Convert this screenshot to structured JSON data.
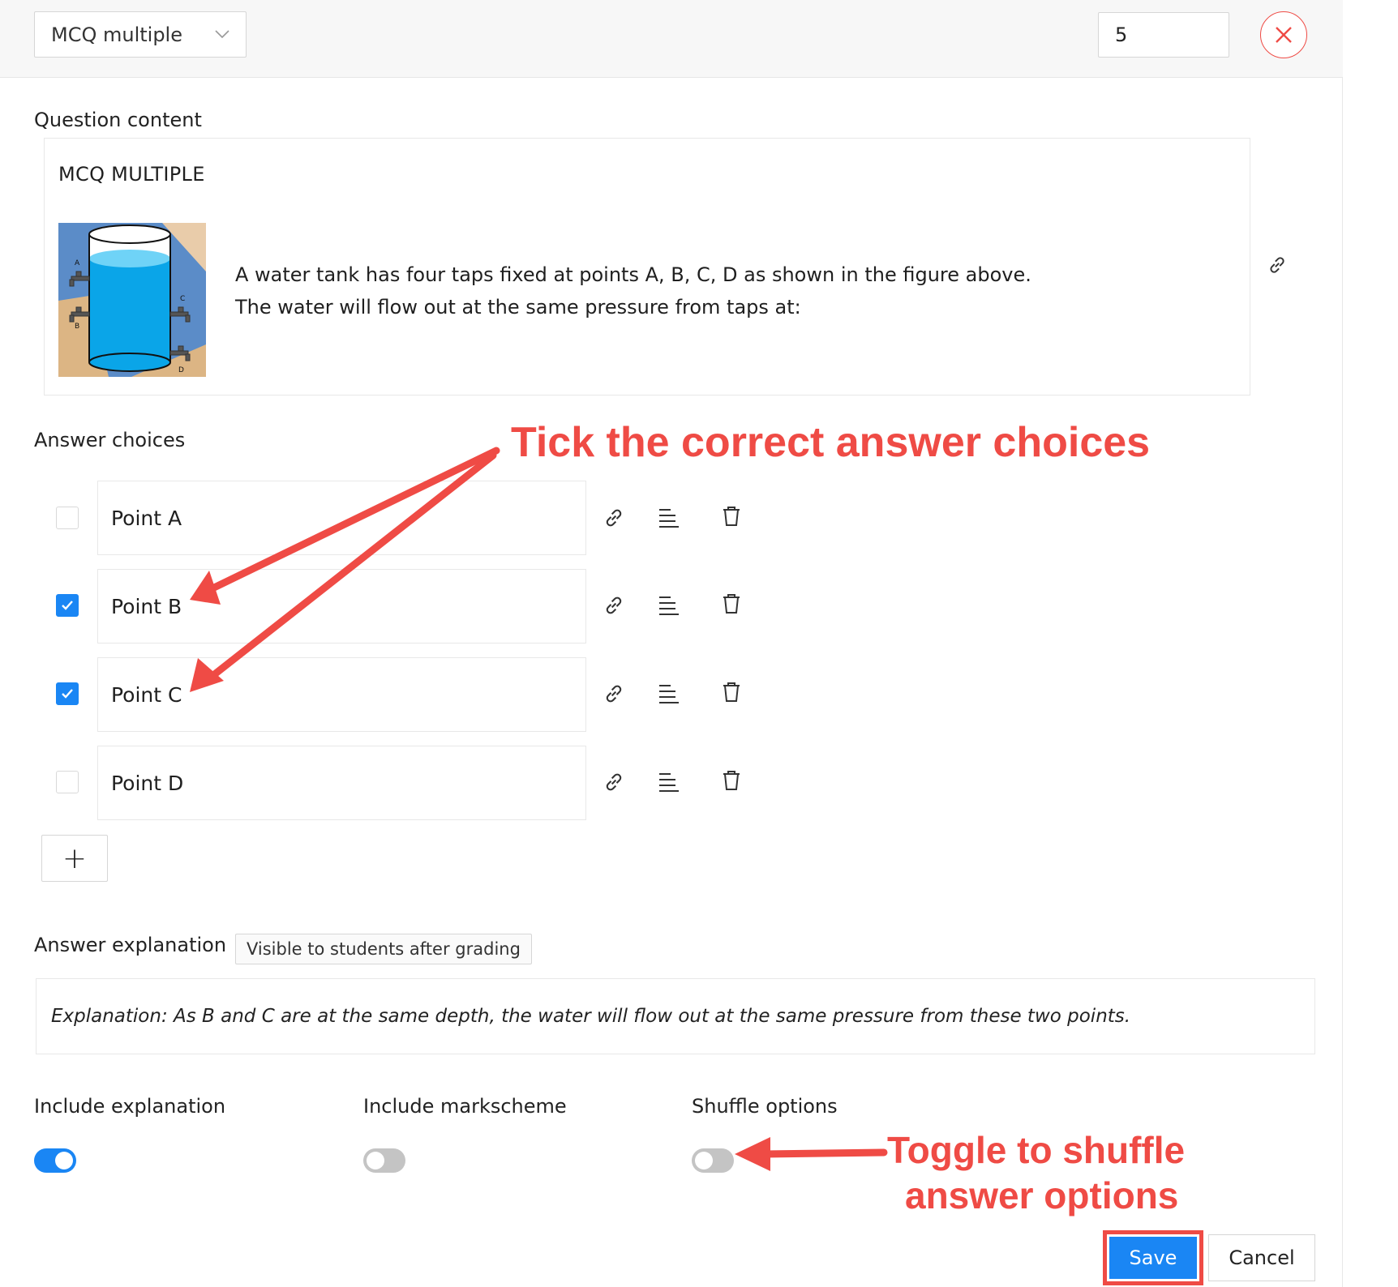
{
  "header": {
    "question_type": "MCQ multiple",
    "marks_value": "5"
  },
  "question": {
    "section_label": "Question content",
    "title": "MCQ MULTIPLE",
    "text_line1": "A water tank has four taps fixed at points A, B, C, D as shown in the figure above.",
    "text_line2": "The water will flow out at the same pressure from taps at:",
    "figure_tap_labels": [
      "A",
      "B",
      "C",
      "D"
    ]
  },
  "answers": {
    "section_label": "Answer choices",
    "choices": [
      {
        "label": "Point A",
        "checked": false
      },
      {
        "label": "Point B",
        "checked": true
      },
      {
        "label": "Point C",
        "checked": true
      },
      {
        "label": "Point D",
        "checked": false
      }
    ],
    "add_label": "+"
  },
  "explanation": {
    "section_label": "Answer explanation",
    "badge": "Visible to students after grading",
    "text": "Explanation: As B and C are at the same depth, the water will flow out at the same pressure from these two points."
  },
  "toggles": [
    {
      "label": "Include explanation",
      "on": true
    },
    {
      "label": "Include markscheme",
      "on": false
    },
    {
      "label": "Shuffle options",
      "on": false
    }
  ],
  "buttons": {
    "save": "Save",
    "cancel": "Cancel"
  },
  "annotations": {
    "tick_note": "Tick the correct answer choices",
    "toggle_note_line1": "Toggle to shuffle",
    "toggle_note_line2": "answer options"
  },
  "colors": {
    "accent": "#1a86f4",
    "annotation": "#ef4b45"
  }
}
